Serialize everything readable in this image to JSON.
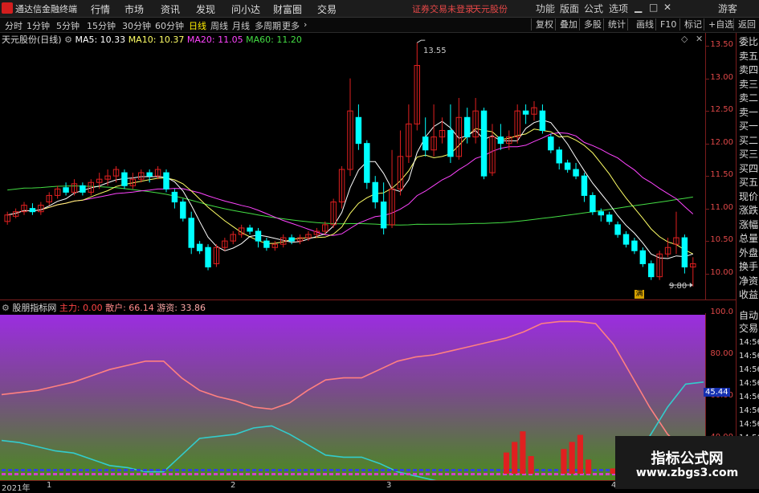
{
  "app": {
    "title": "通达信金融终端"
  },
  "menu": [
    "行情",
    "市场",
    "资讯",
    "发现",
    "问小达",
    "财富圈",
    "交易"
  ],
  "status": {
    "securities": "证券交易未登录",
    "stock": "天元股份"
  },
  "window_buttons": [
    "功能",
    "版面",
    "公式",
    "选项"
  ],
  "user": "游客",
  "periods": [
    "分时",
    "1分钟",
    "5分钟",
    "15分钟",
    "30分钟",
    "60分钟",
    "日线",
    "周线",
    "月线",
    "多周期",
    "更多"
  ],
  "active_period": "日线",
  "toolbar": [
    "复权",
    "叠加",
    "多股",
    "统计",
    "画线",
    "F10",
    "标记",
    "+自选",
    "返回"
  ],
  "main_info": {
    "name": "天元股份(日线)",
    "ma5": "MA5: 10.33",
    "ma10": "MA10: 10.37",
    "ma20": "MA20: 11.05",
    "ma60": "MA60: 11.20"
  },
  "annotations": {
    "high": "13.55",
    "low": "9.80",
    "badge": "满"
  },
  "main_yaxis": [
    "13.50",
    "13.00",
    "12.50",
    "12.00",
    "11.50",
    "11.00",
    "10.50",
    "10.00"
  ],
  "indicator": {
    "name": "股朋指标网",
    "zl": "主力: 0.00",
    "sh": "散户: 66.14",
    "yz": "游资: 33.86",
    "marker": "45.44"
  },
  "ind_yaxis": [
    "100.0",
    "80.00",
    "60.00",
    "40.00"
  ],
  "side_panel": [
    "委比",
    "卖五",
    "卖四",
    "卖三",
    "卖二",
    "卖一",
    "买一",
    "买二",
    "买三",
    "买四",
    "买五",
    "现价",
    "涨跌",
    "涨幅",
    "总量",
    "外盘",
    "换手",
    "净资",
    "收益"
  ],
  "side_panel2": [
    "自动",
    "交易"
  ],
  "side_times": [
    "14:56",
    "14:56",
    "14:56",
    "14:56",
    "14:56",
    "14:56",
    "14:56",
    "14:56",
    "14:56"
  ],
  "dates": [
    "2021年",
    "1",
    "2",
    "3",
    "4"
  ],
  "watermark": {
    "line1": "指标公式网",
    "line2": "www.zbgs3.com"
  },
  "colors": {
    "up": "#e02020",
    "down": "#00ffff",
    "ma5": "#ffffff",
    "ma10": "#ffff66",
    "ma20": "#ff44ff",
    "ma60": "#44dd44"
  },
  "chart_data": [
    {
      "type": "candlestick",
      "title": "天元股份(日线)",
      "ylim": [
        9.6,
        13.7
      ],
      "candles": [
        [
          10.8,
          10.9,
          10.75,
          10.95
        ],
        [
          10.88,
          10.95,
          10.85,
          11.0
        ],
        [
          10.95,
          11.05,
          10.9,
          11.1
        ],
        [
          11.0,
          10.95,
          10.9,
          11.08
        ],
        [
          10.95,
          11.05,
          10.9,
          11.1
        ],
        [
          11.1,
          11.2,
          11.05,
          11.25
        ],
        [
          11.2,
          11.3,
          11.15,
          11.35
        ],
        [
          11.32,
          11.25,
          11.2,
          11.4
        ],
        [
          11.25,
          11.38,
          11.2,
          11.45
        ],
        [
          11.35,
          11.25,
          11.2,
          11.4
        ],
        [
          11.25,
          11.4,
          11.2,
          11.45
        ],
        [
          11.4,
          11.45,
          11.3,
          11.55
        ],
        [
          11.45,
          11.5,
          11.35,
          11.6
        ],
        [
          11.5,
          11.6,
          11.4,
          11.65
        ],
        [
          11.55,
          11.35,
          11.3,
          11.6
        ],
        [
          11.35,
          11.45,
          11.3,
          11.55
        ],
        [
          11.45,
          11.55,
          11.4,
          11.6
        ],
        [
          11.55,
          11.5,
          11.4,
          11.6
        ],
        [
          11.5,
          11.6,
          11.45,
          11.65
        ],
        [
          11.55,
          11.3,
          11.25,
          11.6
        ],
        [
          11.25,
          11.1,
          11.0,
          11.3
        ],
        [
          11.1,
          10.85,
          10.8,
          11.15
        ],
        [
          10.85,
          10.4,
          10.3,
          10.95
        ],
        [
          10.45,
          10.35,
          10.3,
          10.5
        ],
        [
          10.4,
          10.1,
          10.05,
          10.45
        ],
        [
          10.15,
          10.4,
          10.1,
          10.45
        ],
        [
          10.4,
          10.5,
          10.35,
          10.55
        ],
        [
          10.5,
          10.6,
          10.45,
          10.65
        ],
        [
          10.6,
          10.7,
          10.55,
          10.75
        ],
        [
          10.7,
          10.65,
          10.6,
          10.75
        ],
        [
          10.65,
          10.5,
          10.4,
          10.7
        ],
        [
          10.5,
          10.4,
          10.35,
          10.55
        ],
        [
          10.4,
          10.45,
          10.35,
          10.5
        ],
        [
          10.45,
          10.55,
          10.4,
          10.6
        ],
        [
          10.55,
          10.5,
          10.45,
          10.6
        ],
        [
          10.5,
          10.55,
          10.45,
          10.6
        ],
        [
          10.55,
          10.6,
          10.5,
          10.65
        ],
        [
          10.6,
          10.65,
          10.55,
          10.7
        ],
        [
          10.65,
          10.75,
          10.6,
          10.8
        ],
        [
          10.75,
          11.1,
          10.7,
          11.15
        ],
        [
          11.1,
          11.6,
          11.0,
          11.65
        ],
        [
          11.6,
          12.5,
          11.5,
          13.0
        ],
        [
          12.4,
          12.0,
          11.9,
          12.6
        ],
        [
          12.0,
          11.4,
          11.3,
          12.05
        ],
        [
          11.4,
          11.1,
          11.0,
          11.5
        ],
        [
          11.1,
          10.7,
          10.6,
          11.4
        ],
        [
          10.75,
          11.3,
          10.7,
          11.9
        ],
        [
          11.3,
          11.8,
          11.2,
          12.2
        ],
        [
          11.8,
          12.3,
          11.7,
          12.6
        ],
        [
          12.3,
          13.2,
          12.2,
          13.55
        ],
        [
          12.1,
          11.9,
          11.8,
          12.4
        ],
        [
          11.9,
          12.1,
          11.8,
          12.6
        ],
        [
          12.1,
          12.2,
          12.0,
          12.4
        ],
        [
          12.2,
          11.8,
          11.7,
          12.6
        ],
        [
          11.8,
          12.4,
          11.75,
          12.7
        ],
        [
          12.4,
          12.1,
          12.0,
          12.55
        ],
        [
          12.1,
          12.5,
          12.0,
          12.7
        ],
        [
          12.5,
          11.5,
          11.45,
          12.55
        ],
        [
          11.55,
          12.1,
          11.5,
          12.3
        ],
        [
          12.1,
          12.0,
          11.9,
          12.3
        ],
        [
          12.0,
          12.1,
          11.9,
          12.2
        ],
        [
          12.1,
          12.5,
          12.0,
          12.6
        ],
        [
          12.5,
          12.45,
          12.3,
          12.6
        ],
        [
          12.45,
          12.55,
          12.35,
          12.65
        ],
        [
          12.5,
          12.2,
          12.15,
          12.6
        ],
        [
          12.1,
          11.9,
          11.85,
          12.15
        ],
        [
          11.9,
          11.7,
          11.6,
          11.95
        ],
        [
          11.7,
          11.6,
          11.55,
          11.75
        ],
        [
          11.6,
          11.5,
          11.45,
          11.7
        ],
        [
          11.5,
          11.2,
          11.1,
          11.55
        ],
        [
          11.2,
          10.95,
          10.9,
          11.25
        ],
        [
          10.95,
          10.9,
          10.8,
          11.0
        ],
        [
          10.9,
          10.8,
          10.75,
          10.95
        ],
        [
          10.75,
          10.6,
          10.55,
          10.8
        ],
        [
          10.6,
          10.45,
          10.4,
          10.65
        ],
        [
          10.5,
          10.35,
          10.3,
          10.55
        ],
        [
          10.35,
          10.15,
          10.1,
          10.4
        ],
        [
          10.15,
          9.95,
          9.9,
          10.2
        ],
        [
          9.95,
          10.3,
          9.9,
          10.35
        ],
        [
          10.3,
          10.4,
          10.25,
          10.55
        ],
        [
          10.45,
          10.55,
          10.3,
          10.95
        ],
        [
          10.55,
          10.1,
          10.0,
          10.6
        ],
        [
          10.1,
          10.15,
          9.8,
          10.25
        ]
      ],
      "ma": {
        "MA5": "white",
        "MA10": "yellow",
        "MA20": "magenta",
        "MA60": "green"
      }
    },
    {
      "type": "line",
      "title": "股朋指标网",
      "ylim": [
        20,
        100
      ],
      "series": [
        {
          "name": "散户",
          "color": "#ff8080",
          "values": [
            61,
            62,
            63,
            65,
            67,
            70,
            73,
            75,
            77,
            77,
            69,
            63,
            60,
            58,
            55,
            54,
            57,
            63,
            68,
            69,
            69,
            73,
            77,
            79,
            80,
            82,
            84,
            86,
            88,
            91,
            95,
            96,
            96,
            95,
            85,
            70,
            55,
            42,
            34,
            33
          ]
        },
        {
          "name": "游资",
          "color": "#33cccc",
          "values": [
            39,
            38,
            36,
            34,
            33,
            30,
            27,
            26,
            24,
            24,
            32,
            40,
            41,
            42,
            45,
            46,
            42,
            37,
            32,
            31,
            31,
            28,
            24,
            22,
            20,
            18,
            17,
            16,
            15,
            13,
            10,
            10,
            10,
            11,
            15,
            27,
            41,
            55,
            66,
            67
          ]
        }
      ],
      "bars": [
        {
          "name": "主力",
          "color": "#e02020",
          "values": [
            0,
            0,
            0,
            0,
            0,
            0,
            0,
            0,
            0,
            0,
            0,
            0,
            0,
            0,
            0,
            0,
            0,
            0,
            0,
            0,
            0,
            0,
            0,
            0,
            0,
            0,
            0,
            0,
            0,
            0,
            0,
            0,
            0,
            0,
            0,
            0,
            0,
            0,
            0,
            0,
            0,
            0,
            0,
            0,
            0,
            0,
            0,
            0,
            0,
            0,
            0,
            0,
            0,
            0,
            0,
            0,
            0,
            0,
            0,
            0,
            0,
            12,
            18,
            24,
            10,
            0,
            0,
            0,
            14,
            18,
            22,
            8,
            0,
            0,
            3,
            5,
            2,
            0,
            2,
            0,
            1,
            0,
            0,
            1,
            0
          ]
        }
      ]
    }
  ]
}
